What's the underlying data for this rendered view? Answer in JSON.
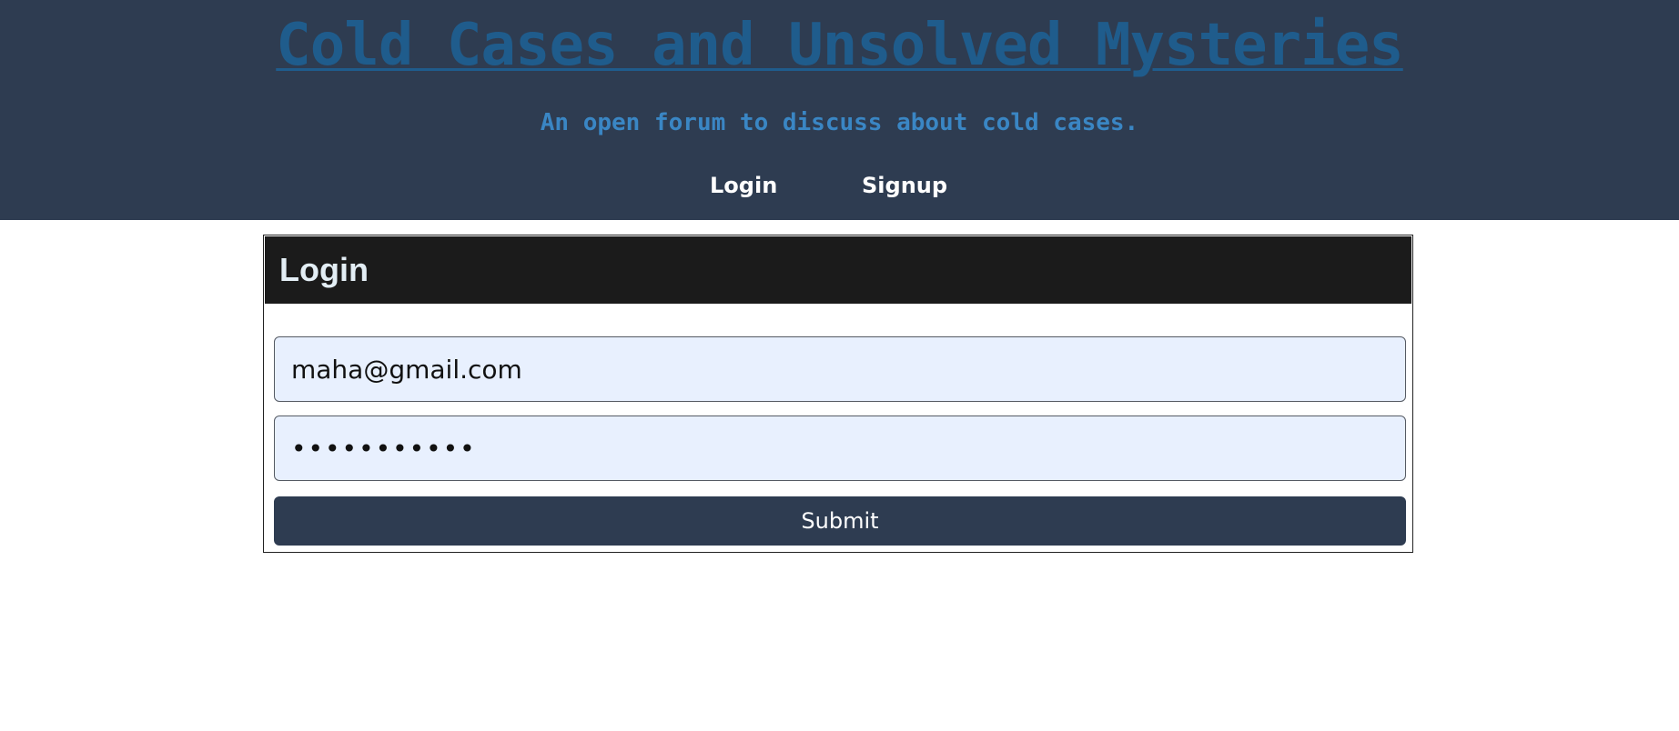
{
  "header": {
    "title": "Cold Cases and Unsolved Mysteries",
    "tagline": "An open forum to discuss about cold cases.",
    "nav": {
      "login_label": "Login",
      "signup_label": "Signup"
    }
  },
  "login_form": {
    "title": "Login",
    "email_value": "maha@gmail.com",
    "password_value": "•••••••••••",
    "submit_label": "Submit"
  },
  "colors": {
    "header_bg": "#2e3c51",
    "title_link": "#1f5c8c",
    "tagline": "#3a86c4",
    "card_header_bg": "#1b1b1b",
    "input_bg": "#e8f0fe",
    "button_bg": "#2e3c51"
  }
}
